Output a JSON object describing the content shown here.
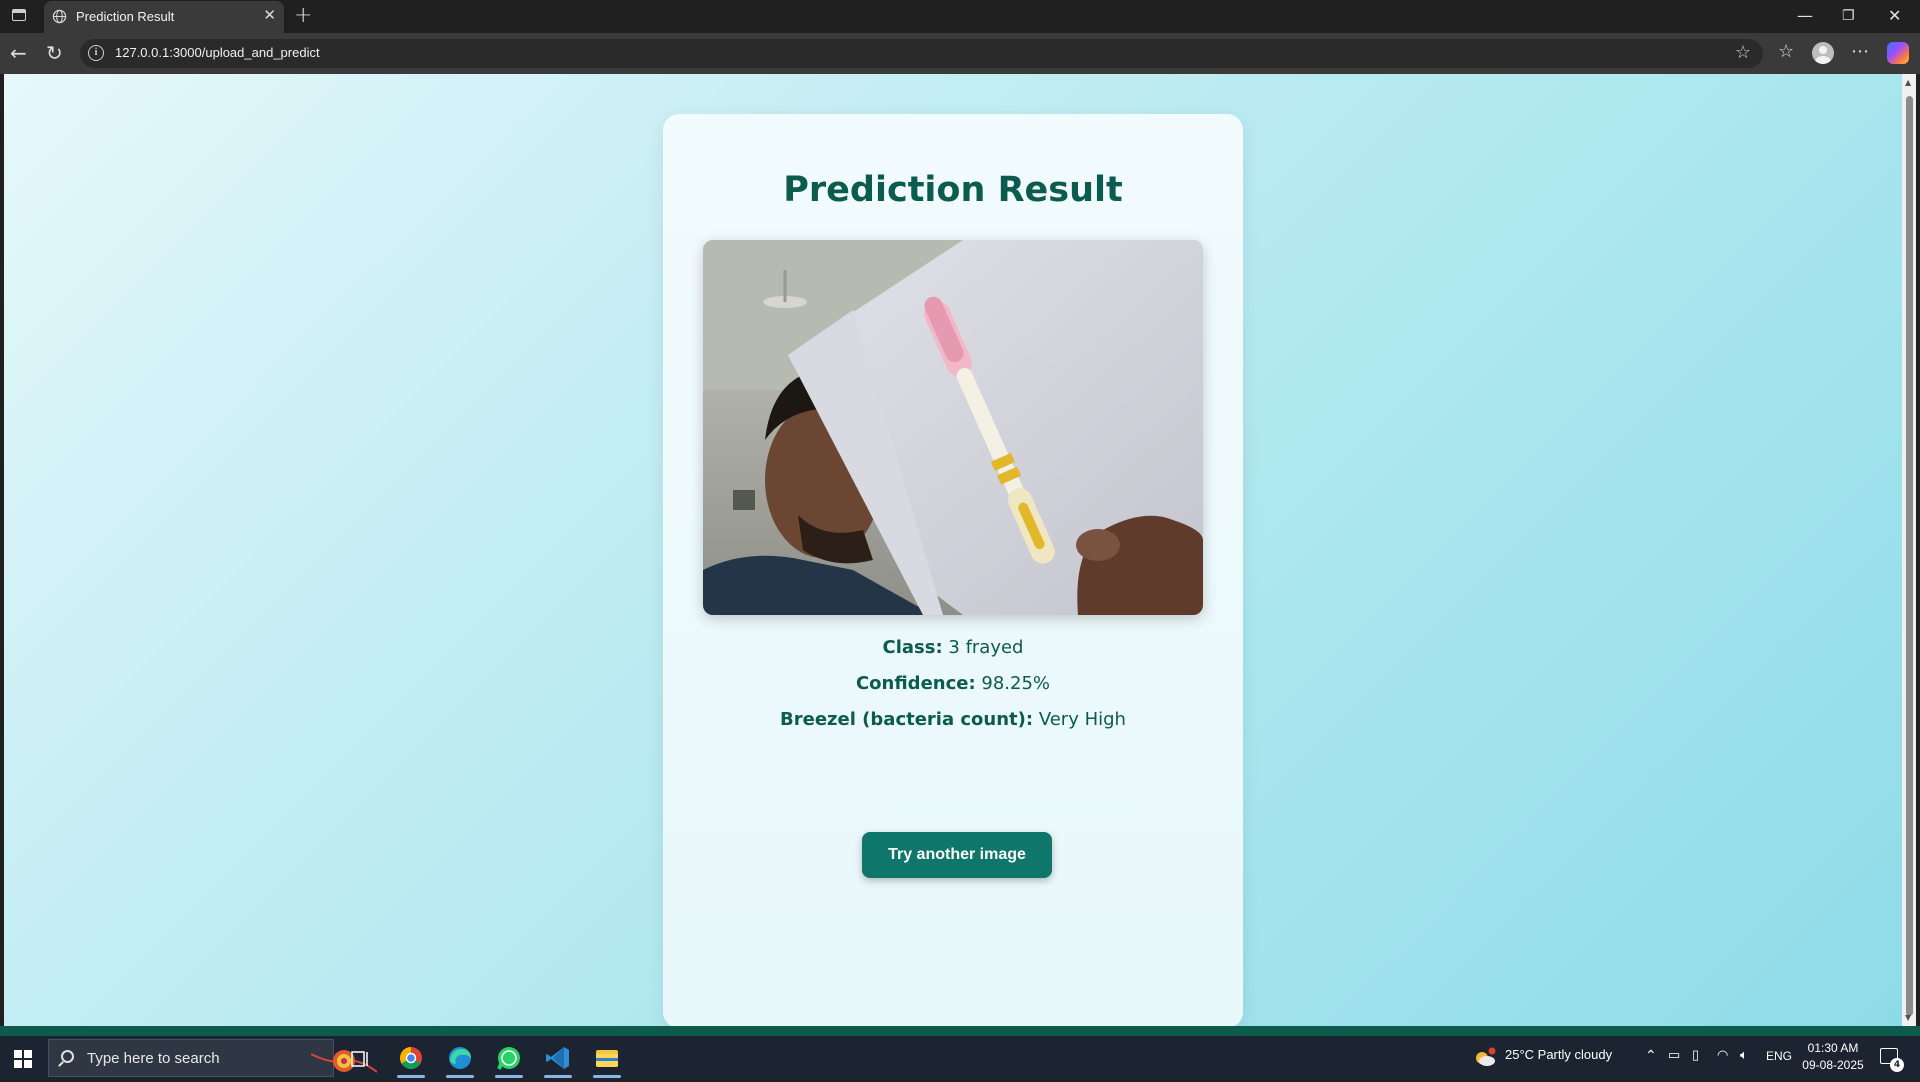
{
  "browser": {
    "tab_title": "Prediction Result",
    "url": "127.0.0.1:3000/upload_and_predict"
  },
  "page": {
    "title": "Prediction Result",
    "image_icon": "uploaded-photo-toothbrush",
    "class_label": "Class:",
    "class_value": "3 frayed",
    "confidence_label": "Confidence:",
    "confidence_value": "98.25%",
    "bacteria_label": "Breezel (bacteria count):",
    "bacteria_value": "Very High",
    "button_label": "Try another image",
    "colors": {
      "title": "#0b5b4f",
      "button": "#0f766b",
      "background_start": "#e6f8fb",
      "background_end": "#8edbe8"
    }
  },
  "taskbar": {
    "search_placeholder": "Type here to search",
    "weather": "25°C  Partly cloudy",
    "language": "ENG",
    "time": "01:30 AM",
    "date": "09-08-2025",
    "notification_count": "4",
    "pinned_apps": [
      "chrome-icon",
      "edge-icon",
      "whatsapp-icon",
      "vscode-icon",
      "file-explorer-icon"
    ]
  }
}
